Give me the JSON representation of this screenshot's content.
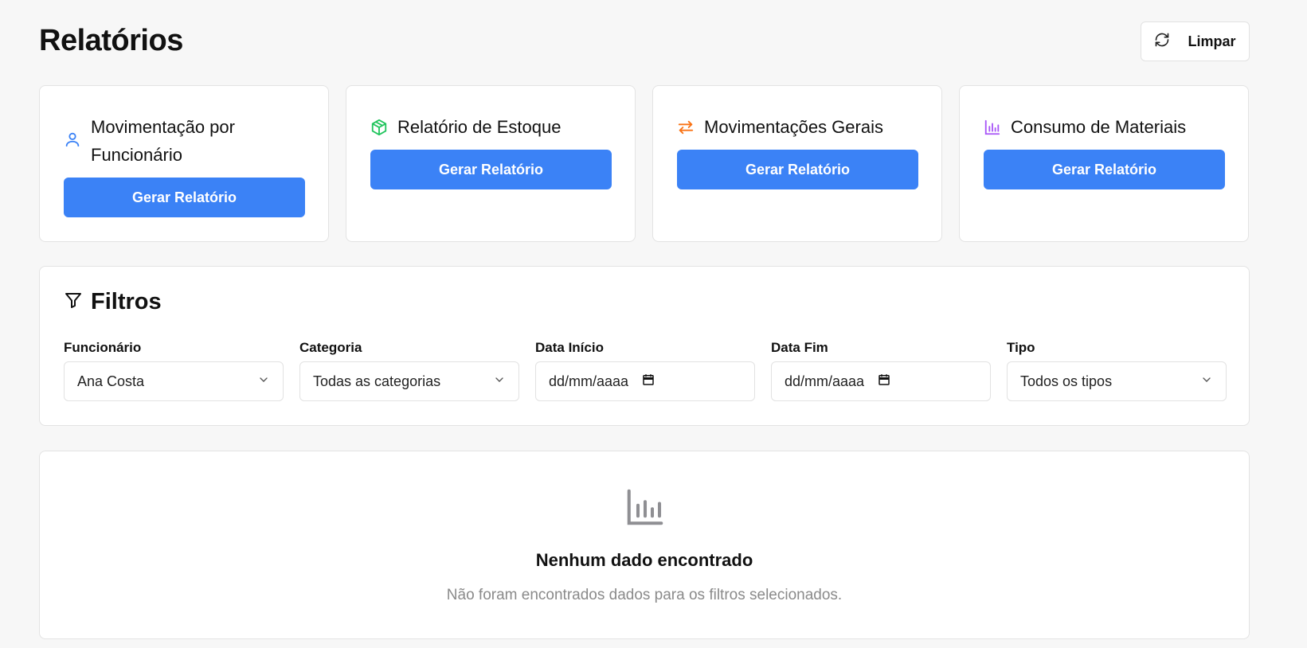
{
  "page": {
    "title": "Relatórios",
    "clear_label": "Limpar"
  },
  "cards": [
    {
      "title": "Movimentação por Funcionário",
      "button": "Gerar Relatório",
      "icon": "user-icon",
      "color": "#3b82f6"
    },
    {
      "title": "Relatório de Estoque",
      "button": "Gerar Relatório",
      "icon": "package-icon",
      "color": "#22c55e"
    },
    {
      "title": "Movimentações Gerais",
      "button": "Gerar Relatório",
      "icon": "swap-arrows-icon",
      "color": "#f97316"
    },
    {
      "title": "Consumo de Materiais",
      "button": "Gerar Relatório",
      "icon": "bar-chart-icon",
      "color": "#a855f7"
    }
  ],
  "filters": {
    "title": "Filtros",
    "fields": [
      {
        "label": "Funcionário",
        "value": "Ana Costa",
        "kind": "select"
      },
      {
        "label": "Categoria",
        "value": "Todas as categorias",
        "kind": "select"
      },
      {
        "label": "Data Início",
        "value": "dd/mm/aaaa",
        "kind": "date"
      },
      {
        "label": "Data Fim",
        "value": "dd/mm/aaaa",
        "kind": "date"
      },
      {
        "label": "Tipo",
        "value": "Todos os tipos",
        "kind": "select"
      }
    ]
  },
  "empty_state": {
    "title": "Nenhum dado encontrado",
    "subtitle": "Não foram encontrados dados para os filtros selecionados.",
    "icon": "bar-chart-icon"
  },
  "colors": {
    "primary": "#3b82f6",
    "muted_text": "#8a8a8a",
    "background": "#f7f7f7"
  }
}
